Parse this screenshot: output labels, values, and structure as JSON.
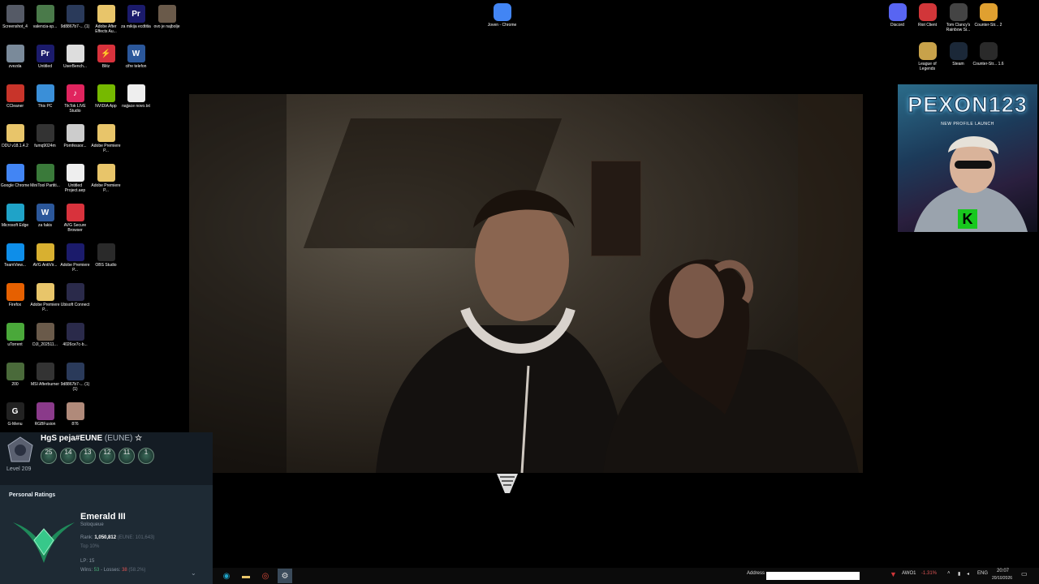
{
  "desktop_icons_left": [
    {
      "label": "Screenshot_4",
      "color": "#555a66",
      "glyph": ""
    },
    {
      "label": "valencia-sp...",
      "color": "#4a7a4a",
      "glyph": ""
    },
    {
      "label": "9d8867b7-... (1)",
      "color": "#2a3a5a",
      "glyph": ""
    },
    {
      "label": "Adobe After Effects Au...",
      "color": "#e8c56a",
      "glyph": ""
    },
    {
      "label": "za mikija ecdtitia",
      "color": "#1b1b6b",
      "glyph": "Pr"
    },
    {
      "label": "ovo je najbolje",
      "color": "#6a5a4a",
      "glyph": ""
    },
    {
      "label": "zvezda",
      "color": "#7a8a9a",
      "glyph": ""
    },
    {
      "label": "Untitled",
      "color": "#1b1b6b",
      "glyph": "Pr"
    },
    {
      "label": "UserBench...",
      "color": "#dddddd",
      "glyph": ""
    },
    {
      "label": "Blitz",
      "color": "#d8323c",
      "glyph": "⚡"
    },
    {
      "label": "cifre telefon",
      "color": "#2b579a",
      "glyph": "W"
    },
    {
      "label": "CCleaner",
      "color": "#c8342a",
      "glyph": ""
    },
    {
      "label": "This PC",
      "color": "#3a8fd8",
      "glyph": ""
    },
    {
      "label": "TikTok LIVE Studio",
      "color": "#e0245e",
      "glyph": "♪"
    },
    {
      "label": "NVIDIA App",
      "color": "#76b900",
      "glyph": ""
    },
    {
      "label": "najjace novo.txt",
      "color": "#eeeeee",
      "glyph": ""
    },
    {
      "label": "DDU v18.1.4.2",
      "color": "#e8c56a",
      "glyph": ""
    },
    {
      "label": "fumq9024m",
      "color": "#333333",
      "glyph": ""
    },
    {
      "label": "Pornfessor...",
      "color": "#cccccc",
      "glyph": ""
    },
    {
      "label": "Adobe Premiere P...",
      "color": "#e8c56a",
      "glyph": ""
    },
    {
      "label": "Google Chrome",
      "color": "#4285f4",
      "glyph": ""
    },
    {
      "label": "MiniTool Partiti...",
      "color": "#3a7a3a",
      "glyph": ""
    },
    {
      "label": "Untitled Project.aep",
      "color": "#eeeeee",
      "glyph": ""
    },
    {
      "label": "Adobe Premiere P...",
      "color": "#e8c56a",
      "glyph": ""
    },
    {
      "label": "Microsoft Edge",
      "color": "#1fa3c8",
      "glyph": ""
    },
    {
      "label": "za fakis",
      "color": "#2b579a",
      "glyph": "W"
    },
    {
      "label": "AVG Secure Browser",
      "color": "#d8323c",
      "glyph": ""
    },
    {
      "label": "TeamView...",
      "color": "#0e8ee9",
      "glyph": ""
    },
    {
      "label": "AVG AntiVir...",
      "color": "#d8b030",
      "glyph": ""
    },
    {
      "label": "Adobe Premiere P...",
      "color": "#1b1b6b",
      "glyph": ""
    },
    {
      "label": "OBS Studio",
      "color": "#2a2a2a",
      "glyph": ""
    },
    {
      "label": "Firefox",
      "color": "#e66000",
      "glyph": ""
    },
    {
      "label": "Adobe Premiere P...",
      "color": "#e8c56a",
      "glyph": ""
    },
    {
      "label": "Ubisoft Connect",
      "color": "#2a2a4a",
      "glyph": ""
    },
    {
      "label": "uTorrent",
      "color": "#4aa83a",
      "glyph": ""
    },
    {
      "label": "DJI_202511...",
      "color": "#6a5a4a",
      "glyph": ""
    },
    {
      "label": "4026ce7c-b...",
      "color": "#2a2a4a",
      "glyph": ""
    },
    {
      "label": "200",
      "color": "#4a6a3a",
      "glyph": ""
    },
    {
      "label": "MSI Afterburner",
      "color": "#333333",
      "glyph": ""
    },
    {
      "label": "9d8867b7-... (1) (1)",
      "color": "#2a3a5a",
      "glyph": ""
    },
    {
      "label": "G-Menu",
      "color": "#222222",
      "glyph": "G"
    },
    {
      "label": "RGBFusion",
      "color": "#8a3a8a",
      "glyph": ""
    },
    {
      "label": "876",
      "color": "#b08a7a",
      "glyph": ""
    }
  ],
  "desktop_icons_right": [
    {
      "label": "Joven - Chrome",
      "color": "#4285f4"
    },
    {
      "label": "Discord",
      "color": "#5865f2"
    },
    {
      "label": "Riot Client",
      "color": "#d13639"
    },
    {
      "label": "Tom Clancy's Rainbow Si...",
      "color": "#444444"
    },
    {
      "label": "Counter-Str... 2",
      "color": "#e0a030"
    },
    {
      "label": "League of Legends",
      "color": "#c8a24a"
    },
    {
      "label": "Steam",
      "color": "#1b2838"
    },
    {
      "label": "Counter-Str... 1.6",
      "color": "#2a2a2a"
    }
  ],
  "thumbnail": {
    "title": "PEXON123",
    "subtitle": "NEW PROFILE LAUNCH",
    "logo": "K"
  },
  "league": {
    "summoner": "HgS peja#EUNE",
    "region": "(EUNE)",
    "level": "Level 209",
    "mastery_badges": [
      "25",
      "14",
      "13",
      "12",
      "11",
      "1"
    ],
    "section_title": "Personal Ratings",
    "rank": "Emerald III",
    "queue": "Soloqueue",
    "rank_label": "Rank:",
    "rank_value": "1,050,812",
    "rank_regional": "(EUNE: 101,643)",
    "top_percent": "Top 10%",
    "lp": "LP: 15",
    "wins_label": "Wins:",
    "wins": "53",
    "losses_label": "Losses:",
    "losses": "38",
    "winrate": "(58.2%)"
  },
  "taskbar": {
    "address_label": "Address",
    "address_value": "",
    "stock_name": "AWO1",
    "stock_change": "-1.31%",
    "lang": "ENG",
    "time": "20:07",
    "date": "20/10/2026"
  }
}
